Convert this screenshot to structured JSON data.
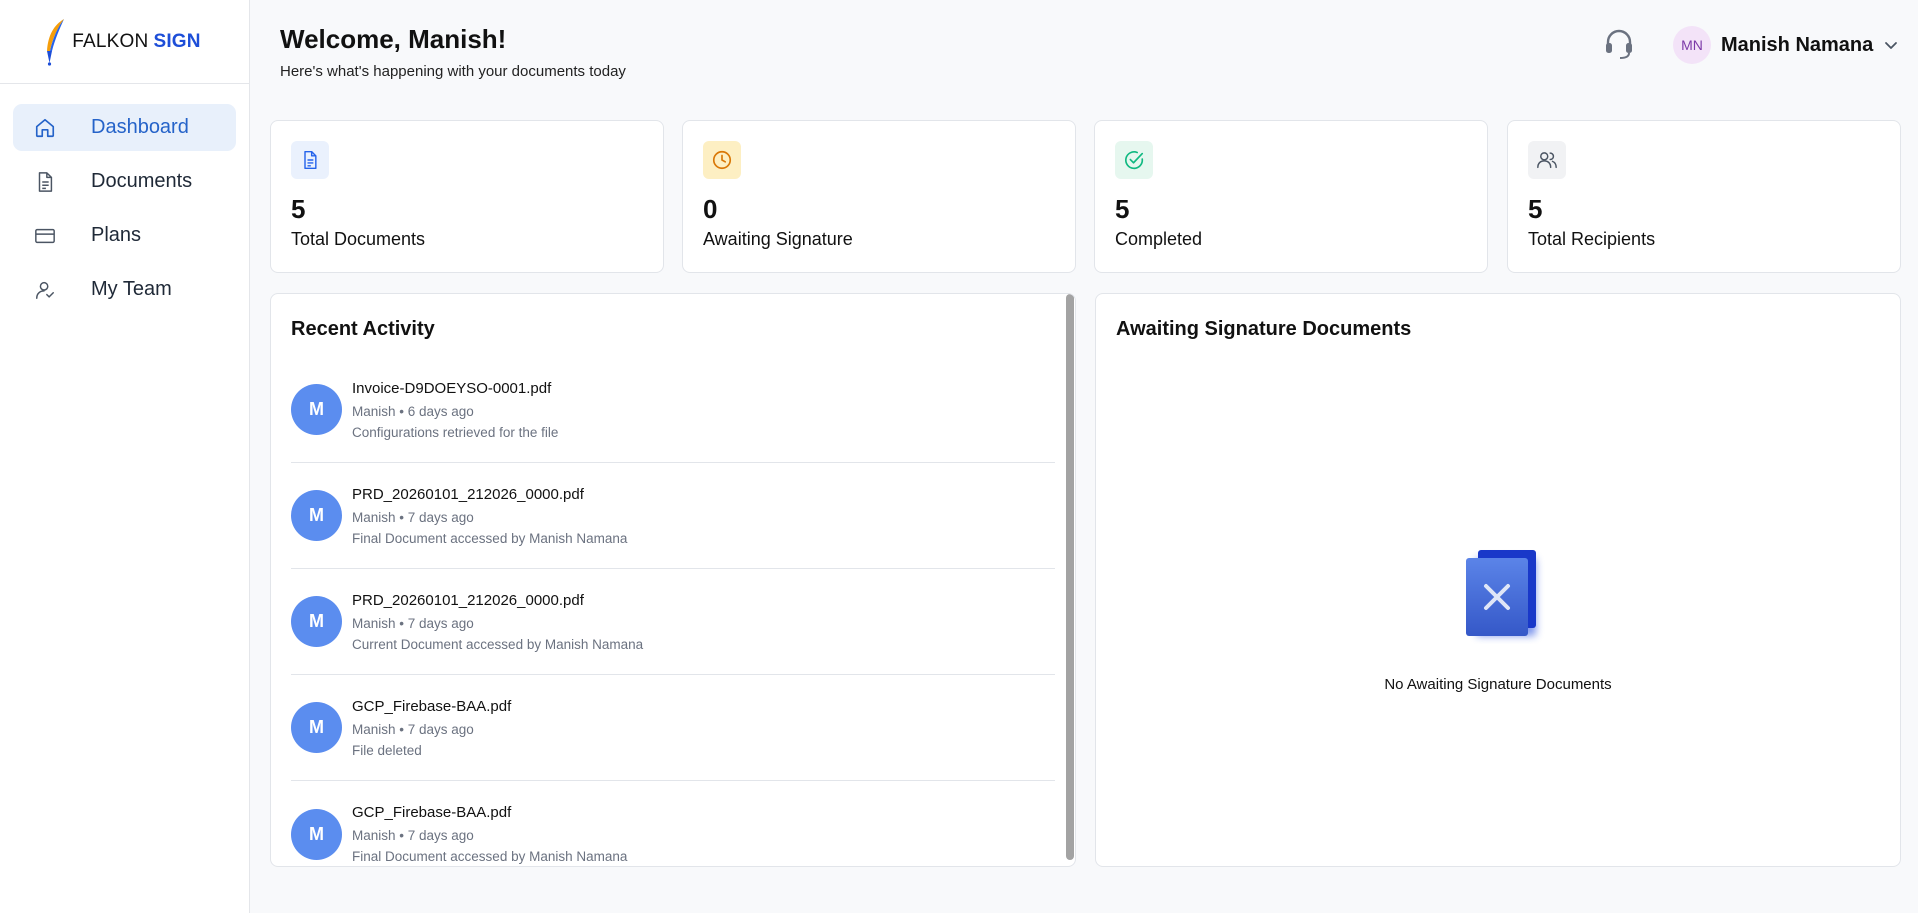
{
  "brand": {
    "name_part1": "FALKON",
    "name_part2": "SIGN"
  },
  "sidebar": {
    "items": [
      {
        "label": "Dashboard",
        "icon": "home-icon",
        "active": true
      },
      {
        "label": "Documents",
        "icon": "document-icon",
        "active": false
      },
      {
        "label": "Plans",
        "icon": "credit-card-icon",
        "active": false
      },
      {
        "label": "My Team",
        "icon": "team-icon",
        "active": false
      }
    ]
  },
  "header": {
    "title": "Welcome, Manish!",
    "subtitle": "Here's what's happening with your documents today",
    "user": {
      "initials": "MN",
      "name": "Manish Namana"
    }
  },
  "stats": [
    {
      "value": "5",
      "label": "Total Documents",
      "icon": "document-icon",
      "color": "#2563eb"
    },
    {
      "value": "0",
      "label": "Awaiting Signature",
      "icon": "clock-icon",
      "color": "#d97706"
    },
    {
      "value": "5",
      "label": "Completed",
      "icon": "check-circle-icon",
      "color": "#10b981"
    },
    {
      "value": "5",
      "label": "Total Recipients",
      "icon": "users-icon",
      "color": "#4b5563"
    }
  ],
  "recent_activity": {
    "title": "Recent Activity",
    "items": [
      {
        "avatar": "M",
        "file": "Invoice-D9DOEYSO-0001.pdf",
        "meta": "Manish • 6 days ago",
        "desc": "Configurations retrieved for the file"
      },
      {
        "avatar": "M",
        "file": "PRD_20260101_212026_0000.pdf",
        "meta": "Manish • 7 days ago",
        "desc": "Final Document accessed by Manish Namana"
      },
      {
        "avatar": "M",
        "file": "PRD_20260101_212026_0000.pdf",
        "meta": "Manish • 7 days ago",
        "desc": "Current Document accessed by Manish Namana"
      },
      {
        "avatar": "M",
        "file": "GCP_Firebase-BAA.pdf",
        "meta": "Manish • 7 days ago",
        "desc": "File deleted"
      },
      {
        "avatar": "M",
        "file": "GCP_Firebase-BAA.pdf",
        "meta": "Manish • 7 days ago",
        "desc": "Final Document accessed by Manish Namana"
      }
    ]
  },
  "awaiting": {
    "title": "Awaiting Signature Documents",
    "empty_text": "No Awaiting Signature Documents"
  },
  "colors": {
    "accent": "#2563c9",
    "avatar_bg": "#5b8def",
    "active_nav_bg": "#e8f0fb"
  }
}
